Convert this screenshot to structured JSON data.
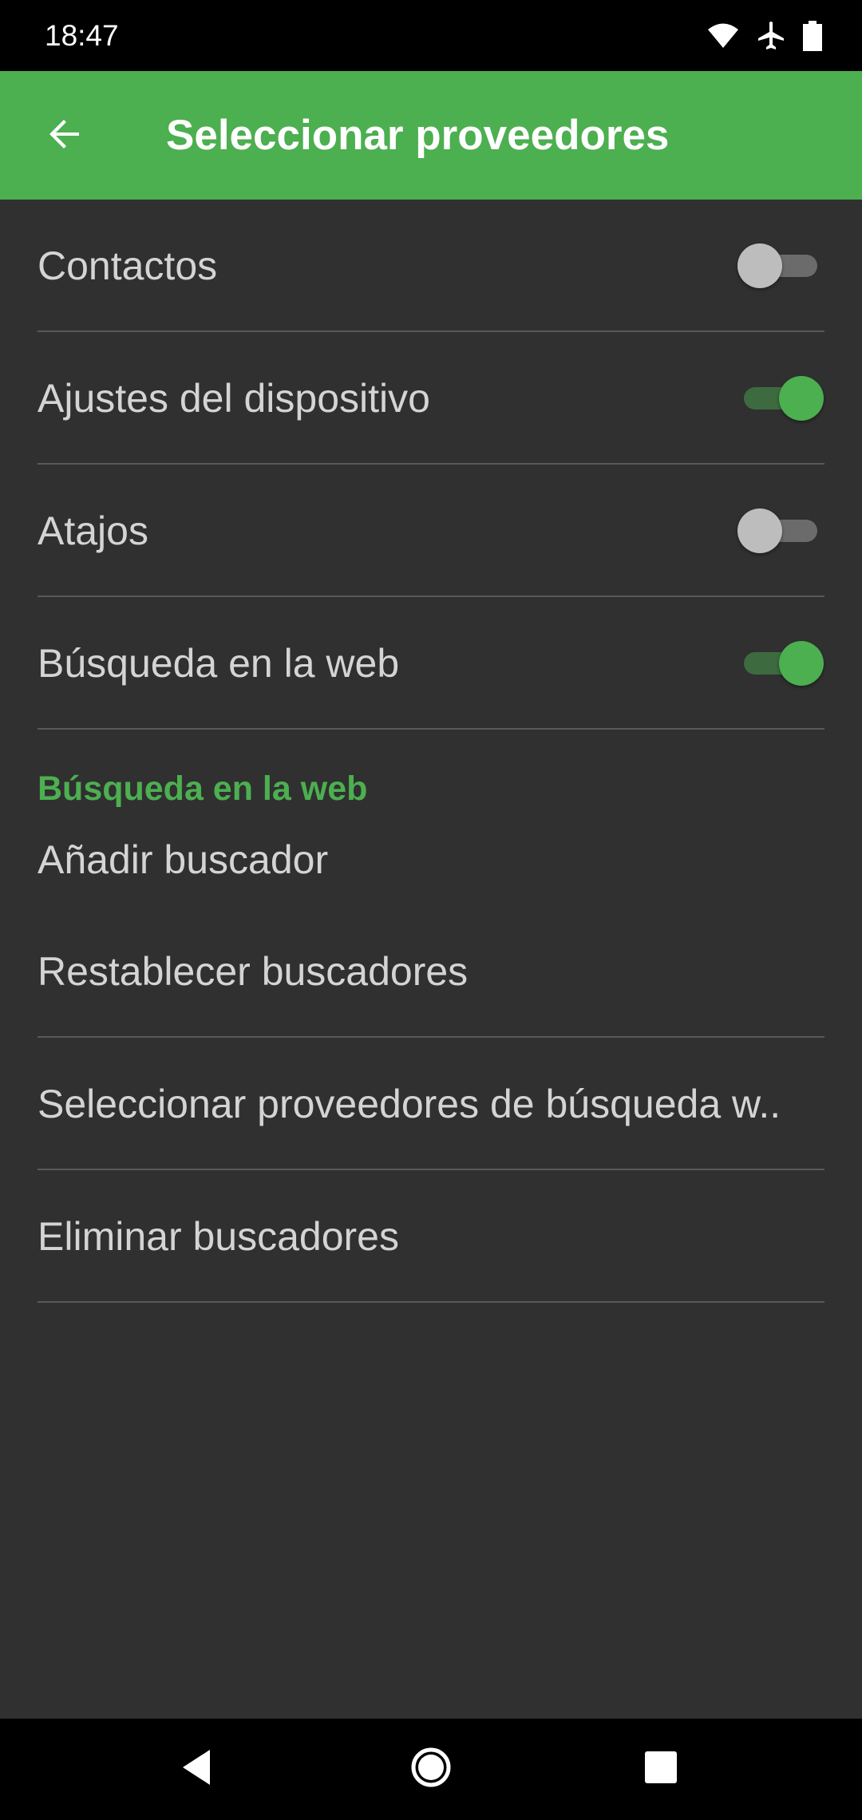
{
  "status_bar": {
    "time": "18:47",
    "icons": [
      "wifi-icon",
      "airplane-icon",
      "battery-icon"
    ]
  },
  "app_bar": {
    "back_icon": "arrow-back-icon",
    "title": "Seleccionar proveedores",
    "color": "#4caf50"
  },
  "toggles": [
    {
      "label": "Contactos",
      "on": false
    },
    {
      "label": "Ajustes del dispositivo",
      "on": true
    },
    {
      "label": "Atajos",
      "on": false
    },
    {
      "label": "Búsqueda en la web",
      "on": true
    }
  ],
  "section": {
    "header": "Búsqueda en la web",
    "items": [
      {
        "label": "Añadir buscador"
      },
      {
        "label": "Restablecer buscadores"
      },
      {
        "label": "Seleccionar proveedores de búsqueda w.."
      },
      {
        "label": "Eliminar buscadores"
      }
    ]
  },
  "nav_bar": {
    "icons": [
      "nav-back-icon",
      "nav-home-icon",
      "nav-recents-icon"
    ]
  }
}
